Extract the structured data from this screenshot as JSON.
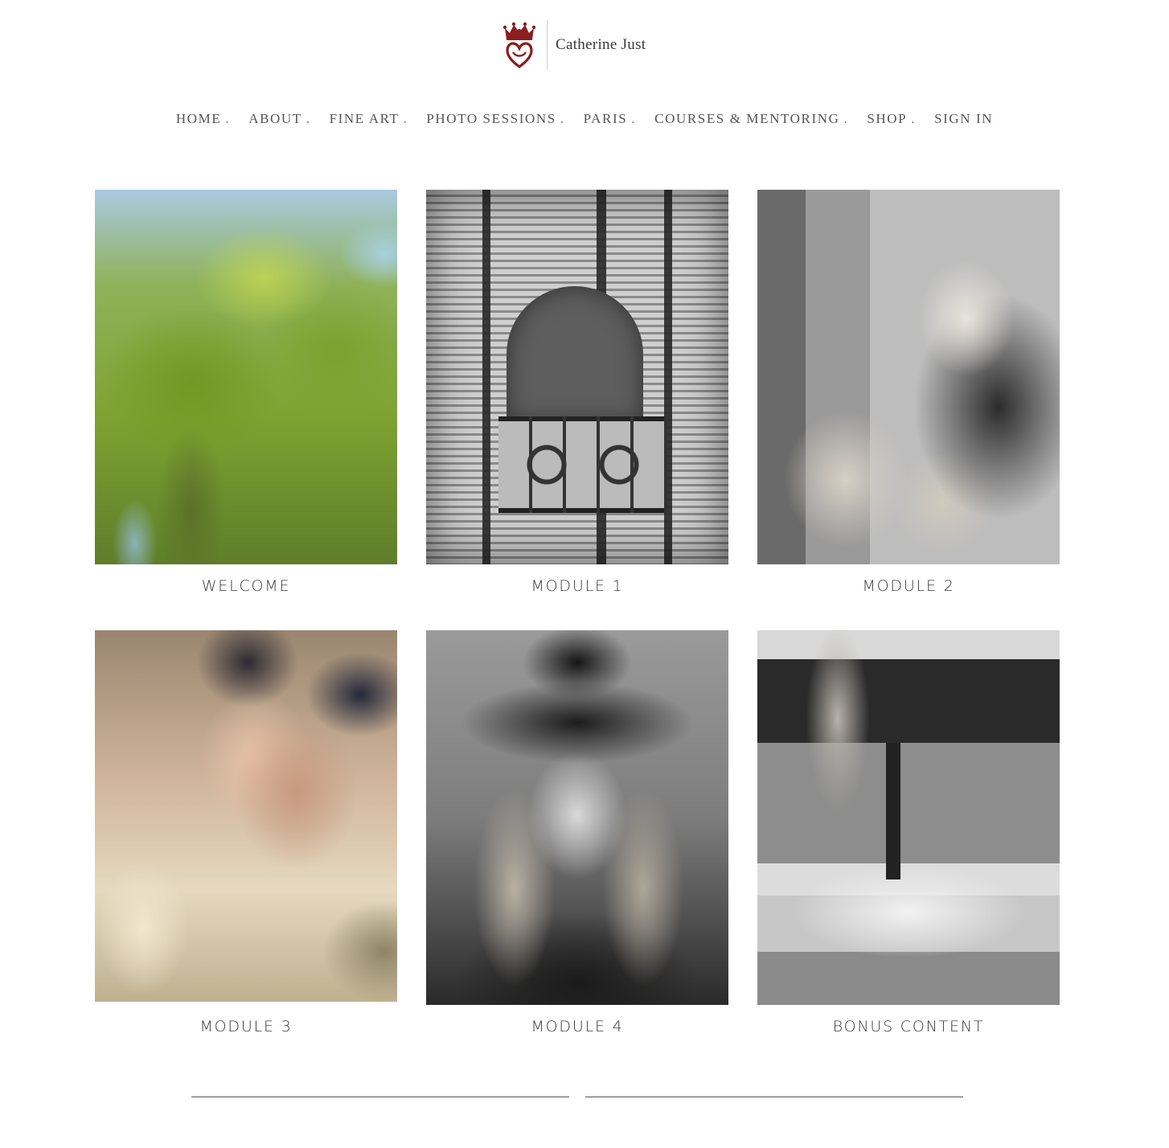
{
  "header": {
    "logo_text": "Catherine Just",
    "logo_icon": "crown-heart-icon",
    "brand_color": "#8b1e1e"
  },
  "nav": {
    "items": [
      {
        "label": "HOME",
        "sep": "."
      },
      {
        "label": "ABOUT",
        "sep": "."
      },
      {
        "label": "FINE ART",
        "sep": "."
      },
      {
        "label": "PHOTO SESSIONS",
        "sep": "."
      },
      {
        "label": "PARIS",
        "sep": "."
      },
      {
        "label": "COURSES & MENTORING",
        "sep": "."
      },
      {
        "label": "SHOP",
        "sep": "."
      },
      {
        "label": "SIGN IN",
        "sep": ""
      }
    ]
  },
  "grid": {
    "tiles": [
      {
        "label": "WELCOME",
        "image": "blurred-tree-photo"
      },
      {
        "label": "MODULE 1",
        "image": "paris-window-shutters-photo"
      },
      {
        "label": "MODULE 2",
        "image": "woman-hand-in-hair-photo"
      },
      {
        "label": "MODULE 3",
        "image": "mother-and-child-photo"
      },
      {
        "label": "MODULE 4",
        "image": "woman-in-black-hat-photo"
      },
      {
        "label": "BONUS CONTENT",
        "image": "jumping-on-bed-photo"
      }
    ]
  }
}
